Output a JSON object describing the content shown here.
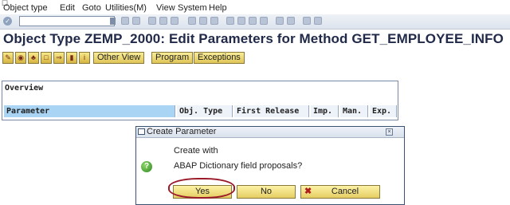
{
  "menu": [
    "Object type",
    "Edit",
    "Goto",
    "Utilities(M)",
    "View",
    "System",
    "Help"
  ],
  "title": "Object Type ZEMP_2000: Edit Parameters for Method GET_EMPLOYEE_INFO",
  "toolbar": {
    "other_view": "Other View",
    "program": "Program",
    "exceptions": "Exceptions"
  },
  "table": {
    "overview": "Overview",
    "headers": [
      "Parameter",
      "Obj. Type",
      "First Release",
      "Imp.",
      "Man.",
      "Exp."
    ]
  },
  "dialog": {
    "title": "Create Parameter",
    "line1": "Create with",
    "line2": "ABAP Dictionary field proposals?",
    "yes": "Yes",
    "no": "No",
    "cancel": "Cancel"
  },
  "colors": {
    "title": "#222a4a",
    "header_selected": "#a9d4f3",
    "annotation": "#9a1a2a"
  }
}
